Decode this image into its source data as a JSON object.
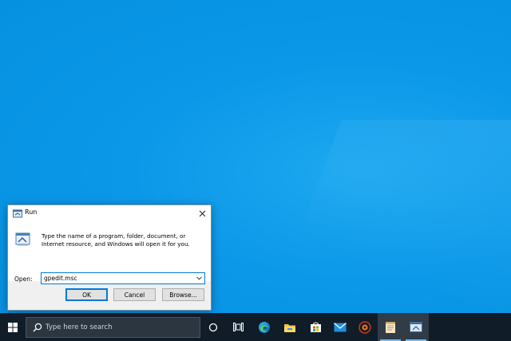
{
  "dialog": {
    "title": "Run",
    "description": "Type the name of a program, folder, document, or Internet resource, and Windows will open it for you.",
    "open_label": "Open:",
    "open_value": "gpedit.msc",
    "ok_label": "OK",
    "cancel_label": "Cancel",
    "browse_label": "Browse..."
  },
  "taskbar": {
    "search_placeholder": "Type here to search",
    "icons": [
      "windows-start-icon",
      "search-icon",
      "cortana-icon",
      "task-view-icon",
      "edge-icon",
      "file-explorer-icon",
      "microsoft-store-icon",
      "mail-icon",
      "app-icon",
      "notepad-icon",
      "run-icon"
    ]
  },
  "colors": {
    "desktop": "#0b98e8",
    "taskbar": "#101c28",
    "accent": "#0078d7"
  }
}
